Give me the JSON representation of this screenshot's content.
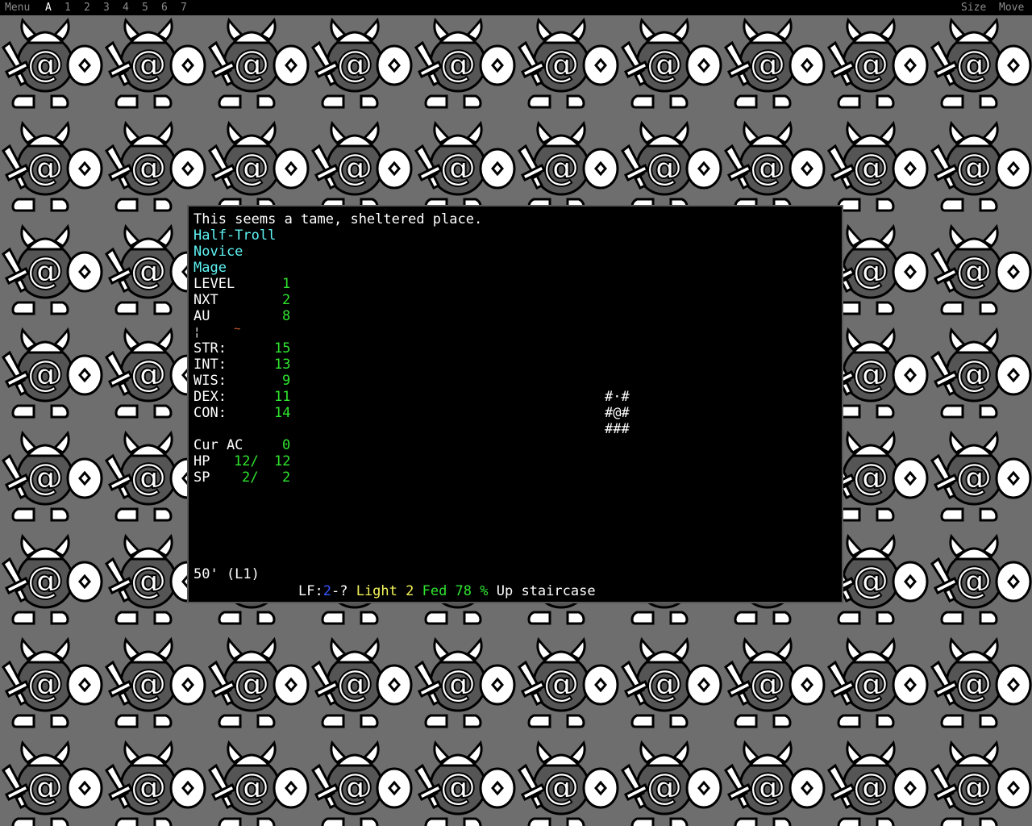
{
  "menubar": {
    "menu": "Menu",
    "tabs": [
      "A",
      "1",
      "2",
      "3",
      "4",
      "5",
      "6",
      "7"
    ],
    "active_tab": "A",
    "size": "Size",
    "move": "Move"
  },
  "background_tile": {
    "icons": [
      "horned-helmet-icon",
      "at-sign-face-icon",
      "dagger-icon",
      "shield-icon",
      "boots-icon"
    ],
    "colors": {
      "bg": "#6e6e6e",
      "fill": "#ffffff",
      "outline": "#000000",
      "body": "#5a5a5a"
    }
  },
  "terminal": {
    "message": "This seems a tame, sheltered place.",
    "race": "Half-Troll",
    "title": "Novice",
    "class": "Mage",
    "stats": [
      {
        "label": "LEVEL",
        "value": "1"
      },
      {
        "label": "NXT",
        "value": "2"
      },
      {
        "label": "AU",
        "value": "8"
      }
    ],
    "equip_row": {
      "a": "¦",
      "b": "~"
    },
    "attributes": [
      {
        "label": "STR:",
        "value": "15"
      },
      {
        "label": "INT:",
        "value": "13"
      },
      {
        "label": "WIS:",
        "value": "9"
      },
      {
        "label": "DEX:",
        "value": "11"
      },
      {
        "label": "CON:",
        "value": "14"
      }
    ],
    "armor": {
      "label": "Cur AC",
      "value": "0"
    },
    "hp": {
      "label": "HP",
      "cur": "12/",
      "max": "12"
    },
    "sp": {
      "label": "SP",
      "cur": "2/",
      "max": "2"
    },
    "map": [
      "#·#",
      "#@#",
      "###"
    ],
    "depth": "50' (L1)",
    "status": {
      "lf_prefix": "LF:",
      "lf_value": "2",
      "lf_suffix": "-?",
      "light": "Light 2",
      "fed": "Fed 78 %",
      "feature": "Up staircase"
    }
  }
}
